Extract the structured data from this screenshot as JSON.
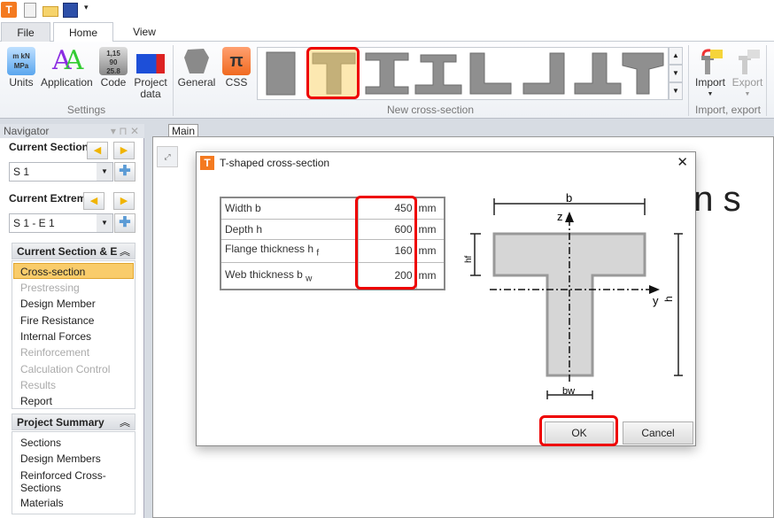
{
  "quick_access": {
    "icons": [
      "app-logo-icon",
      "new-document-icon",
      "open-folder-icon",
      "save-icon",
      "customize-dropdown-icon"
    ]
  },
  "ribbon_tabs": [
    {
      "label": "File"
    },
    {
      "label": "Home",
      "active": true
    },
    {
      "label": "View"
    }
  ],
  "ribbon": {
    "settings": {
      "group_label": "Settings",
      "buttons": [
        {
          "label": "Units"
        },
        {
          "label": "Application"
        },
        {
          "label": "Code"
        },
        {
          "label": "Project data"
        }
      ]
    },
    "new_cross_section": {
      "group_label": "New cross-section",
      "buttons": [
        {
          "label": "General"
        },
        {
          "label": "CSS"
        }
      ],
      "gallery": [
        "rectangle",
        "t-shape",
        "i-shape",
        "i-shape-asymmetric",
        "l-shape",
        "l-shape-mirrored",
        "inverted-t-shape",
        "t-shape-tapered"
      ],
      "selected": "t-shape"
    },
    "import_export": {
      "group_label": "Import, export",
      "buttons": [
        {
          "label": "Import",
          "enabled": true
        },
        {
          "label": "Export",
          "enabled": false
        }
      ]
    }
  },
  "navigator": {
    "title": "Navigator",
    "current_section_label": "Current Section",
    "current_section_value": "S 1",
    "current_extreme_label": "Current Extrem",
    "current_extreme_value": "S 1 - E 1",
    "group1": {
      "title": "Current Section & E",
      "items": [
        {
          "label": "Cross-section",
          "state": "selected"
        },
        {
          "label": "Prestressing",
          "state": "disabled"
        },
        {
          "label": "Design Member",
          "state": "enabled"
        },
        {
          "label": "Fire Resistance",
          "state": "enabled"
        },
        {
          "label": "Internal Forces",
          "state": "enabled"
        },
        {
          "label": "Reinforcement",
          "state": "disabled"
        },
        {
          "label": "Calculation Control",
          "state": "disabled"
        },
        {
          "label": "Results",
          "state": "disabled"
        },
        {
          "label": "Report",
          "state": "enabled"
        }
      ]
    },
    "group2": {
      "title": "Project Summary",
      "items": [
        {
          "label": "Sections"
        },
        {
          "label": "Design Members"
        },
        {
          "label": "Reinforced Cross-Sections"
        },
        {
          "label": "Materials"
        }
      ]
    }
  },
  "main": {
    "tab": "Main",
    "background_text": "en s"
  },
  "dialog": {
    "title": "T-shaped cross-section",
    "rows": [
      {
        "name": "Width b",
        "sub": "",
        "value": "450",
        "unit": "mm"
      },
      {
        "name": "Depth h",
        "sub": "",
        "value": "600",
        "unit": "mm"
      },
      {
        "name": "Flange thickness h",
        "sub": "f",
        "value": "160",
        "unit": "mm"
      },
      {
        "name": "Web thickness b",
        "sub": "w",
        "value": "200",
        "unit": "mm"
      }
    ],
    "diagram": {
      "b": "b",
      "h": "h",
      "hf": "hf",
      "bw": "bw",
      "z": "z",
      "y": "y"
    },
    "ok_label": "OK",
    "cancel_label": "Cancel"
  },
  "colors": {
    "highlight": "#e00000",
    "selected_item": "#f9cc6b",
    "accent": "#f47a20"
  }
}
